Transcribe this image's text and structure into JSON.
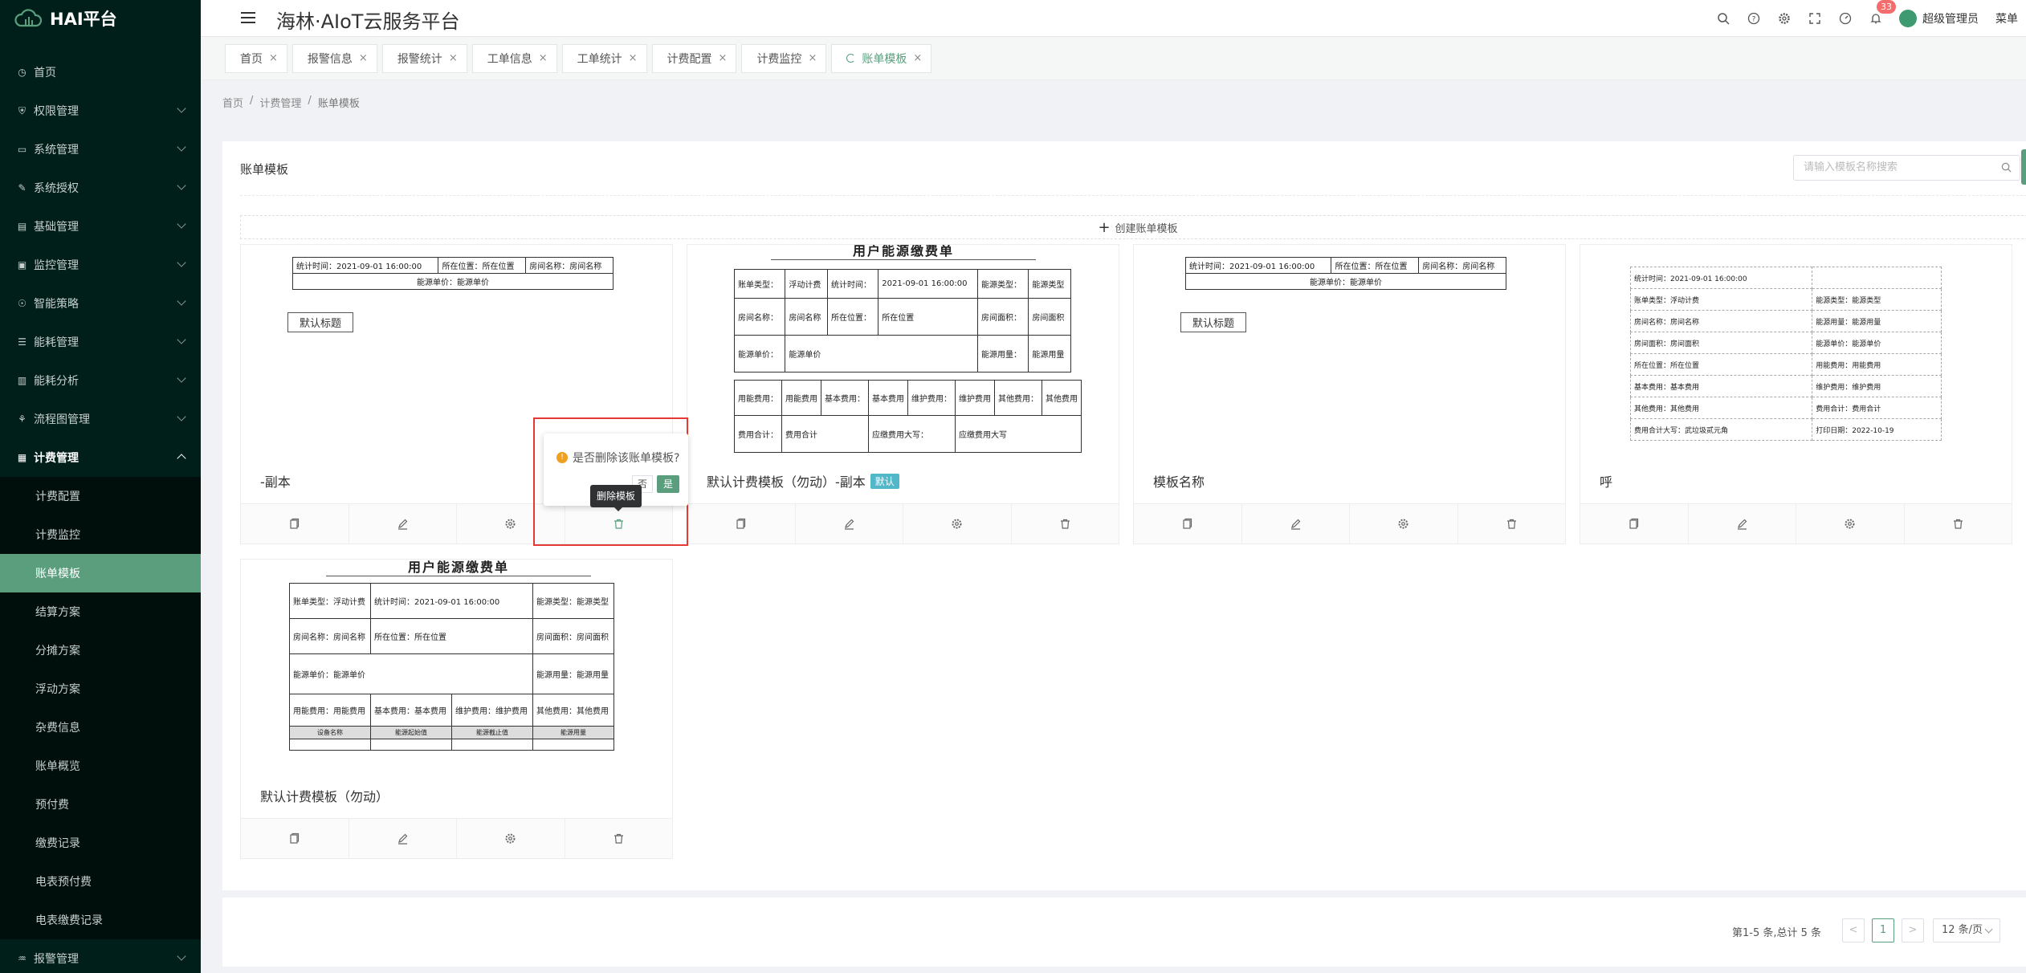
{
  "app": {
    "logo_text": "HAI平台",
    "header_title": "海林·AIoT云服务平台"
  },
  "header": {
    "notification_count": "33",
    "username": "超级管理员",
    "extra": "菜单"
  },
  "sidebar": {
    "items": [
      {
        "label": "首页",
        "icon": "dashboard-icon"
      },
      {
        "label": "权限管理",
        "icon": "shield-icon"
      },
      {
        "label": "系统管理",
        "icon": "monitor-icon"
      },
      {
        "label": "系统授权",
        "icon": "edit-icon"
      },
      {
        "label": "基础管理",
        "icon": "server-icon"
      },
      {
        "label": "监控管理",
        "icon": "screen-icon"
      },
      {
        "label": "智能策略",
        "icon": "bulb-icon"
      },
      {
        "label": "能耗管理",
        "icon": "sliders-icon"
      },
      {
        "label": "能耗分析",
        "icon": "chart-icon"
      },
      {
        "label": "流程图管理",
        "icon": "flow-icon"
      },
      {
        "label": "计费管理",
        "icon": "billing-icon"
      }
    ],
    "billing_sub": [
      "计费配置",
      "计费监控",
      "账单模板",
      "结算方案",
      "分摊方案",
      "浮动方案",
      "杂费信息",
      "账单概览",
      "预付费",
      "缴费记录",
      "电表预付费",
      "电表缴费记录"
    ],
    "bottom_item": "报警管理"
  },
  "tabs": [
    "首页",
    "报警信息",
    "报警统计",
    "工单信息",
    "工单统计",
    "计费配置",
    "计费监控",
    "账单模板"
  ],
  "breadcrumb": [
    "首页",
    "计费管理",
    "账单模板"
  ],
  "main": {
    "title": "账单模板",
    "search_placeholder": "请输入模板名称搜索",
    "create_label": "创建账单模板"
  },
  "cards": [
    {
      "name": "-副本",
      "tag": ""
    },
    {
      "name": "默认计费模板（勿动）-副本",
      "tag": "默认"
    },
    {
      "name": "模板名称",
      "tag": ""
    },
    {
      "name": "呼",
      "tag": ""
    },
    {
      "name": "默认计费模板（勿动）",
      "tag": ""
    }
  ],
  "previews": {
    "simple": {
      "row1": [
        "统计时间：2021-09-01 16:00:00",
        "所在位置：所在位置",
        "房间名称：房间名称"
      ],
      "row2": "能源单价：能源单价",
      "default_title": "默认标题"
    },
    "full": {
      "title": "用户能源缴费单",
      "r1": [
        "账单类型：",
        "浮动计费",
        "统计时间：",
        "2021-09-01 16:00:00",
        "能源类型：",
        "能源类型"
      ],
      "r2": [
        "房间名称：",
        "房间名称",
        "所在位置：",
        "所在位置",
        "房间面积：",
        "房间面积"
      ],
      "r3": [
        "能源单价：",
        "能源单价",
        "能源用量：",
        "能源用量"
      ],
      "r4": [
        "用能费用：",
        "用能费用",
        "基本费用：",
        "基本费用",
        "维护费用：",
        "维护费用",
        "其他费用：",
        "其他费用"
      ],
      "r5": [
        "费用合计：",
        "费用合计",
        "应缴费用大写：",
        "应缴费用大写"
      ]
    },
    "full2": {
      "title": "用户能源缴费单",
      "r1": [
        "账单类型：浮动计费",
        "统计时间：2021-09-01 16:00:00",
        "能源类型：能源类型"
      ],
      "r2": [
        "房间名称：房间名称",
        "所在位置：所在位置",
        "房间面积：房间面积"
      ],
      "r3": [
        "能源单价：能源单价",
        "能源用量：能源用量"
      ],
      "r4": [
        "用能费用：用能费用",
        "基本费用：基本费用",
        "维护费用：维护费用",
        "其他费用：其他费用"
      ],
      "r5": [
        "设备名称",
        "能源起始值",
        "能源截止值",
        "能源用量"
      ]
    },
    "list": [
      [
        "统计时间：2021-09-01 16:00:00",
        ""
      ],
      [
        "账单类型：浮动计费",
        "能源类型：能源类型"
      ],
      [
        "房间名称：房间名称",
        "能源用量：能源用量"
      ],
      [
        "房间面积：房间面积",
        "能源单价：能源单价"
      ],
      [
        "所在位置：所在位置",
        "用能费用：用能费用"
      ],
      [
        "基本费用：基本费用",
        "维护费用：维护费用"
      ],
      [
        "其他费用：其他费用",
        "费用合计：费用合计"
      ],
      [
        "费用合计大写：武垃圾贰元角",
        "打印日期：2022-10-19"
      ]
    ]
  },
  "popconfirm": {
    "message": "是否删除该账单模板?",
    "no": "否",
    "yes": "是",
    "tooltip": "删除模板"
  },
  "pagination": {
    "total": "第1-5 条,总计 5 条",
    "prev": "<",
    "page": "1",
    "next": ">",
    "size": "12 条/页"
  },
  "colors": {
    "accent": "#5a9e7e",
    "sidebar": "#001f1a",
    "danger": "#e53935",
    "tag": "#50b8c8"
  }
}
